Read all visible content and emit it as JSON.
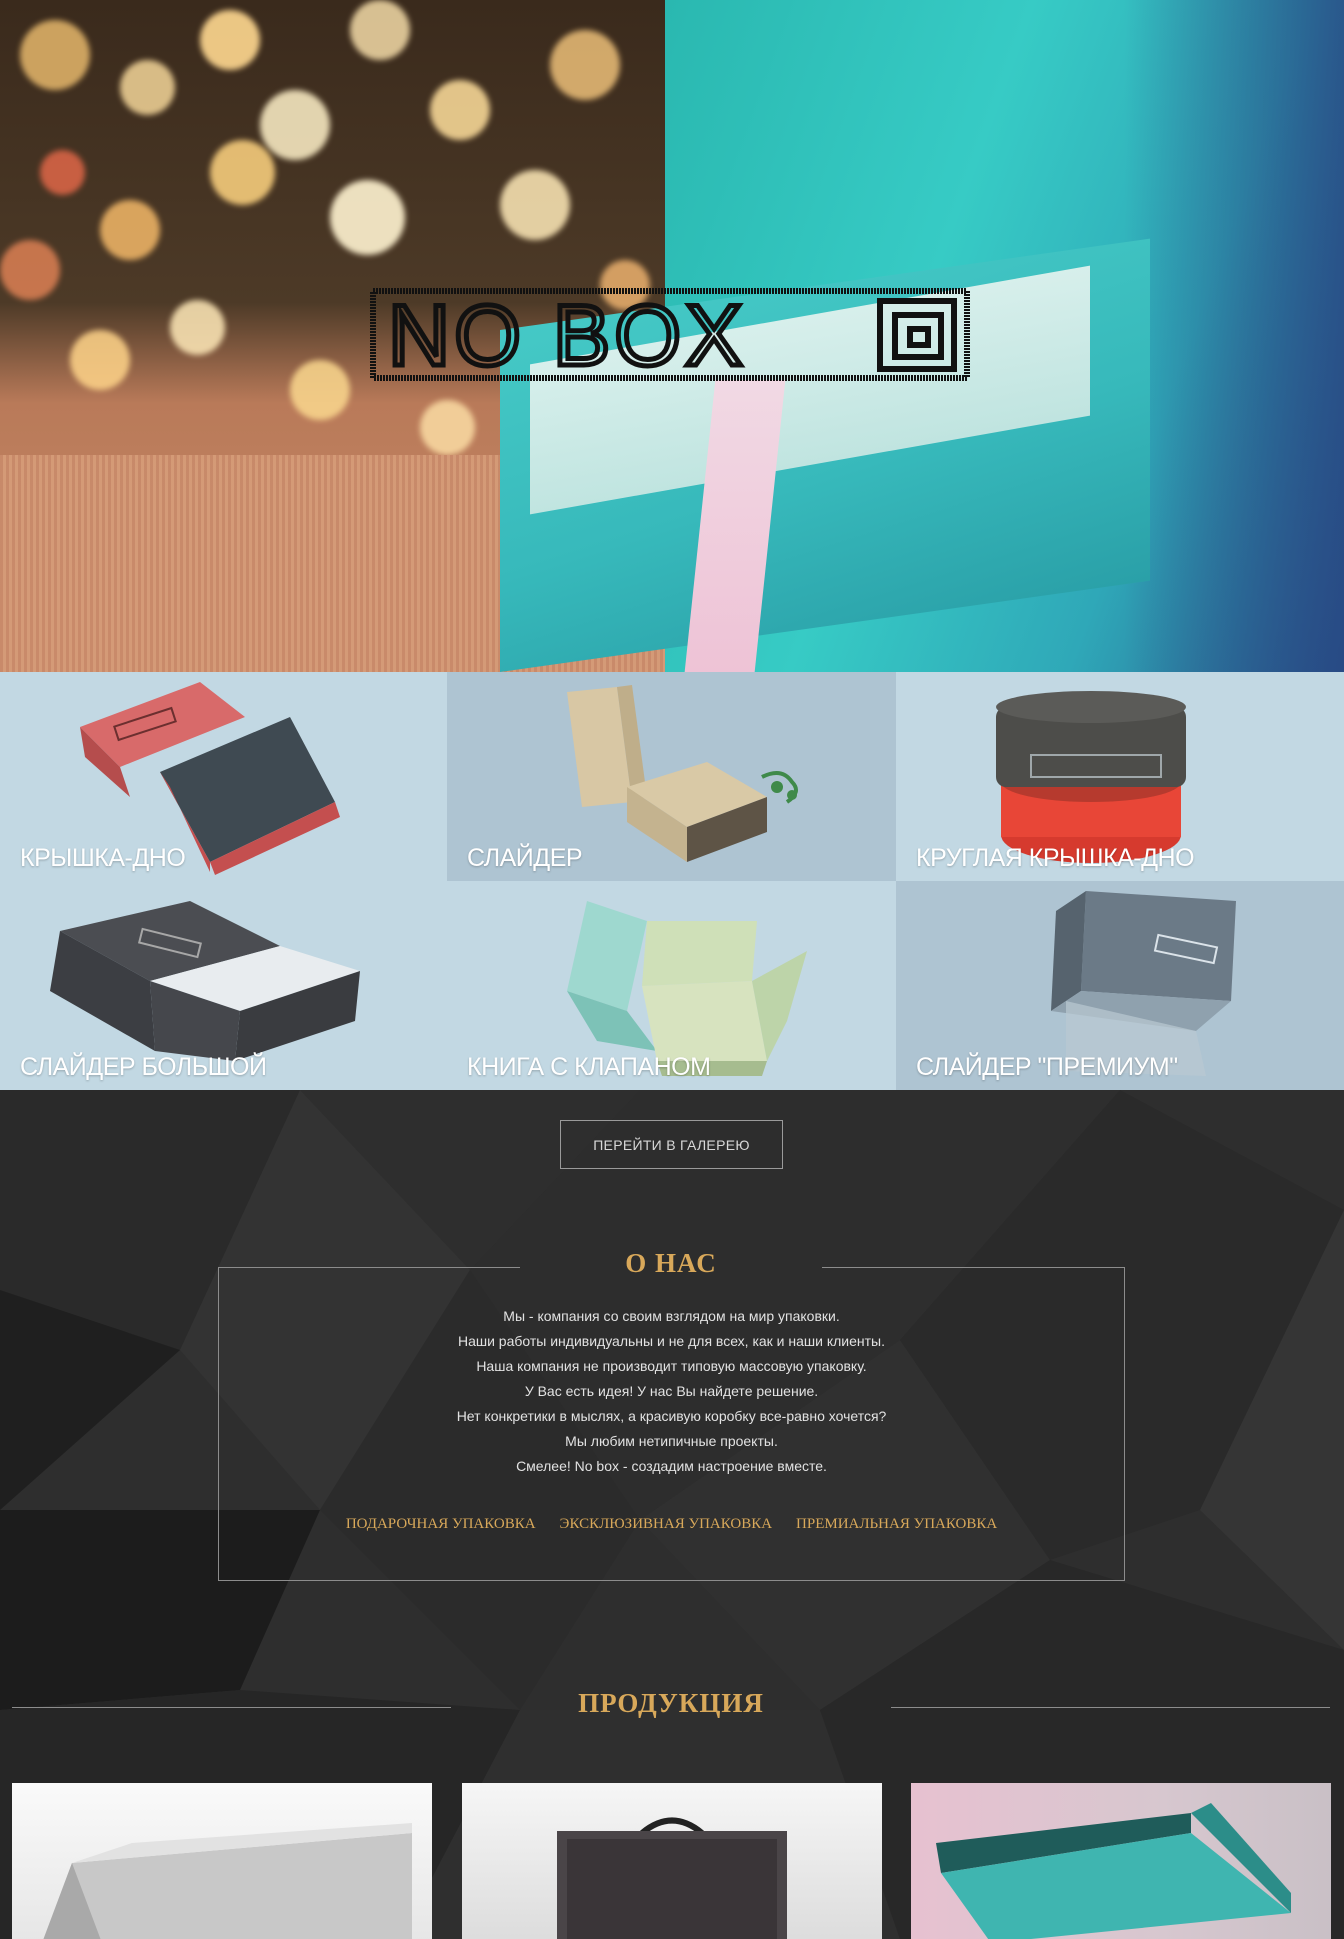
{
  "hero": {
    "logo_text": "NO BOX",
    "logo_icon": "square-spiral-icon"
  },
  "categories": [
    {
      "label": "КРЫШКА-ДНО"
    },
    {
      "label": "СЛАЙДЕР"
    },
    {
      "label": "КРУГЛАЯ КРЫШКА-ДНО"
    },
    {
      "label": "СЛАЙДЕР БОЛЬШОЙ"
    },
    {
      "label": "КНИГА С КЛАПАНОМ"
    },
    {
      "label": "СЛАЙДЕР \"ПРЕМИУМ\""
    }
  ],
  "gallery_button": "ПЕРЕЙТИ В ГАЛЕРЕЮ",
  "about": {
    "title": "О НАС",
    "lines": [
      "Мы - компания со своим взглядом на мир упаковки.",
      "Наши работы индивидуальны и не для всех, как и наши клиенты.",
      "Наша компания не производит типовую массовую упаковку.",
      "У Вас есть идея! У нас Вы найдете решение.",
      "Нет конкретики в мыслях, а красивую коробку все-равно хочется?",
      "Мы любим нетипичные проекты.",
      "Смелее! No box - создадим настроение вместе."
    ],
    "links": [
      "ПОДАРОЧНАЯ УПАКОВКА",
      "ЭКСКЛЮЗИВНАЯ УПАКОВКА",
      "ПРЕМИАЛЬНАЯ УПАКОВКА"
    ]
  },
  "products": {
    "title": "ПРОДУКЦИЯ"
  },
  "colors": {
    "accent_gold": "#d8a85a",
    "dark_bg": "#2e2e2e",
    "tile_bg": "#c2d8e3"
  }
}
